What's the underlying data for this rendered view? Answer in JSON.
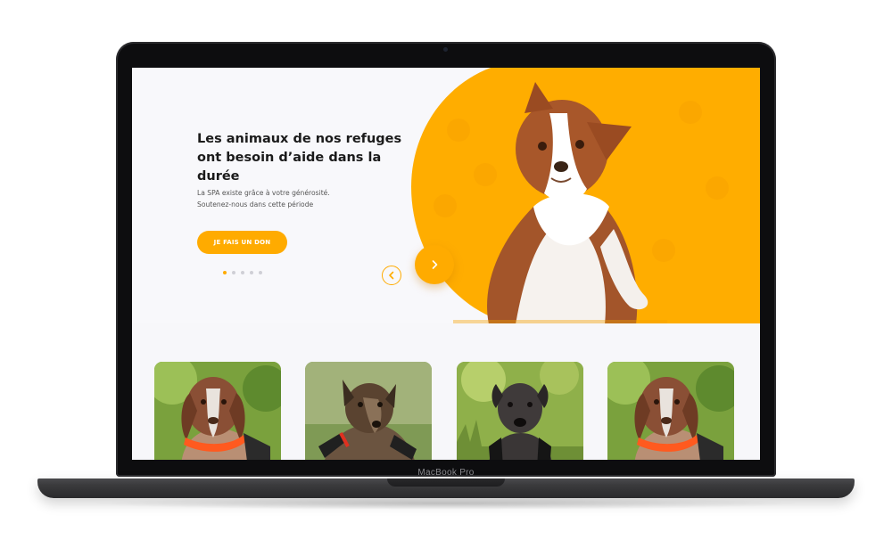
{
  "device": {
    "brand_label": "MacBook Pro"
  },
  "hero": {
    "title_line1": "Les animaux de nos refuges",
    "title_line2": "ont besoin d’aide dans la durée",
    "subtitle_line1": "La SPA existe grâce à votre générosité.",
    "subtitle_line2": "Soutenez-nous dans cette période",
    "donate_label": "JE FAIS UN DON",
    "slides_count": 5,
    "active_slide": 1,
    "image": "dog-photo (border collie, brown and white)"
  },
  "cards": [
    {
      "image": "dog-photo (brown and white pointer, orange collar)"
    },
    {
      "image": "dog-photo (brindle dog, harness)"
    },
    {
      "image": "dog-photo (dark grey dog, grass)"
    },
    {
      "image": "dog-photo (brown and white pointer, orange collar)"
    }
  ],
  "colors": {
    "accent": "#ffab00",
    "hero_background": "#f8f8fb",
    "title_text": "#1b1b1b"
  },
  "icons": {
    "prev": "chevron-left-icon",
    "next": "chevron-right-icon"
  }
}
